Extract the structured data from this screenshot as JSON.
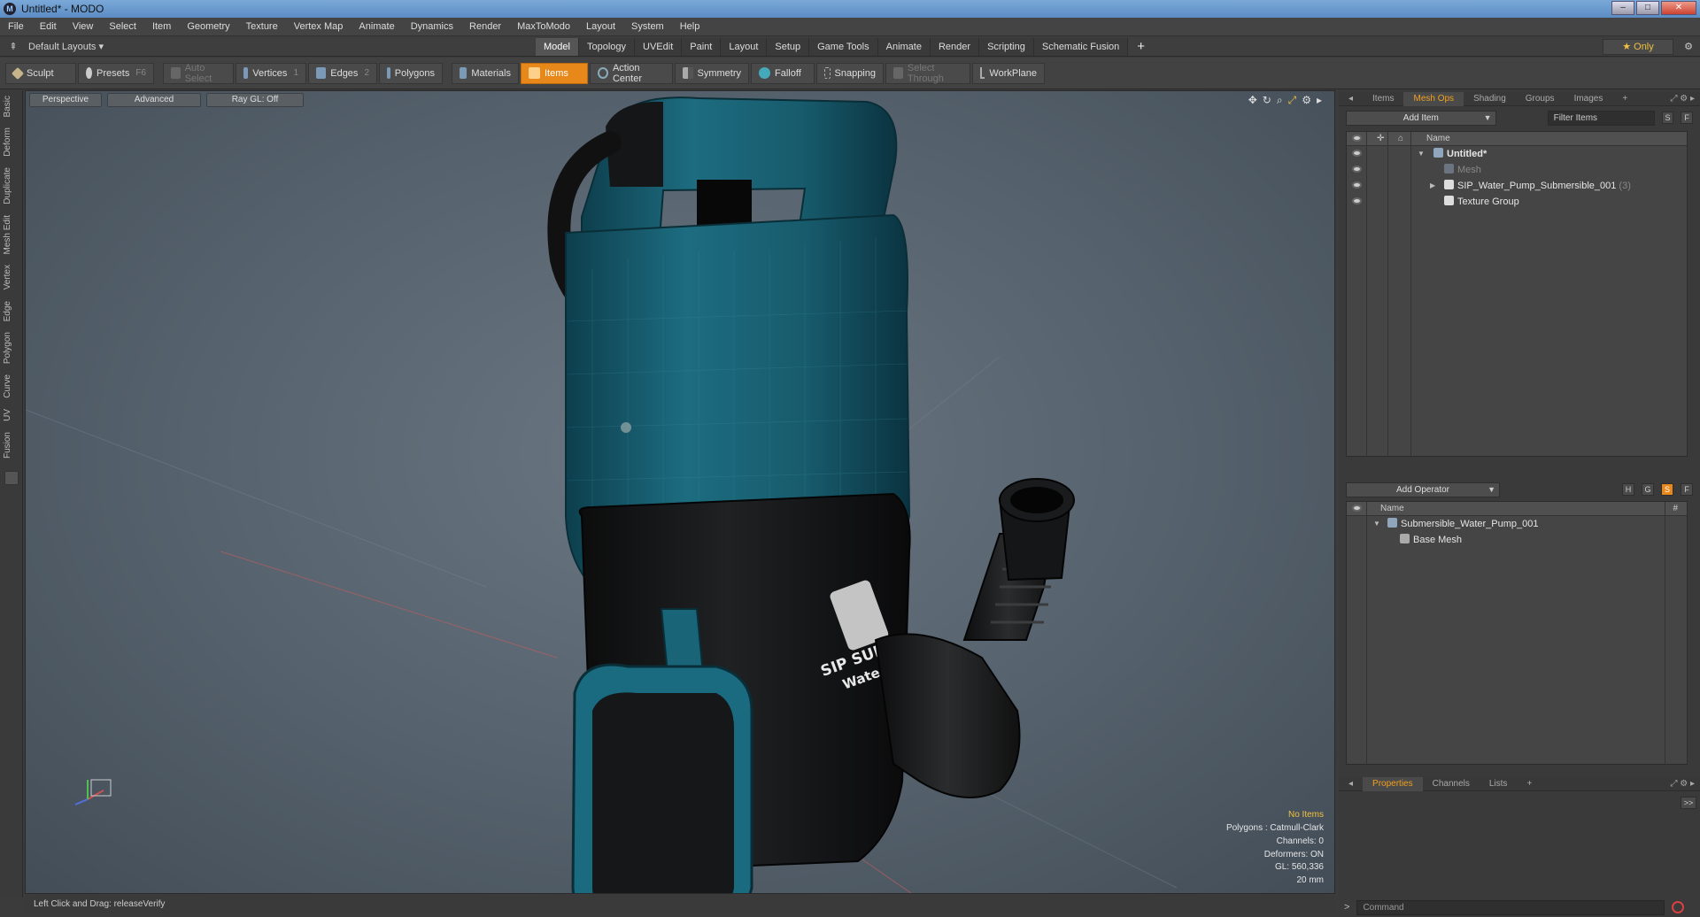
{
  "window": {
    "title": "Untitled* - MODO",
    "app_icon": "modo-logo-icon"
  },
  "menu": [
    "File",
    "Edit",
    "View",
    "Select",
    "Item",
    "Geometry",
    "Texture",
    "Vertex Map",
    "Animate",
    "Dynamics",
    "Render",
    "MaxToModo",
    "Layout",
    "System",
    "Help"
  ],
  "layout_bar": {
    "layout_name": "Default Layouts ▾",
    "tabs": [
      "Model",
      "Topology",
      "UVEdit",
      "Paint",
      "Layout",
      "Setup",
      "Game Tools",
      "Animate",
      "Render",
      "Scripting",
      "Schematic Fusion"
    ],
    "active_tab": "Model",
    "only_label": "★  Only"
  },
  "toolbar": {
    "sculpt": "Sculpt",
    "presets": "Presets",
    "presets_key": "F6",
    "auto_select": "Auto Select",
    "vertices": "Vertices",
    "vertices_key": "1",
    "edges": "Edges",
    "edges_key": "2",
    "polygons": "Polygons",
    "materials": "Materials",
    "items": "Items",
    "action_center": "Action Center",
    "symmetry": "Symmetry",
    "falloff": "Falloff",
    "snapping": "Snapping",
    "select_through": "Select Through",
    "workplane": "WorkPlane"
  },
  "left_tabs": [
    "Basic",
    "Deform",
    "Duplicate",
    "Mesh Edit",
    "Vertex",
    "Edge",
    "Polygon",
    "Curve",
    "UV",
    "Fusion"
  ],
  "viewport": {
    "view": "Perspective",
    "shading": "Advanced",
    "raygl": "Ray GL: Off",
    "logo_text": "SIP SUB",
    "logo_text2": "Water P",
    "stats": {
      "no_items": "No Items",
      "polygons": "Polygons : Catmull-Clark",
      "channels": "Channels: 0",
      "deformers": "Deformers: ON",
      "gl": "GL: 560,336",
      "scale": "20 mm"
    }
  },
  "status": "Left Click and Drag:  releaseVerify",
  "items_panel": {
    "tabs": [
      "Items",
      "Mesh Ops",
      "Shading",
      "Groups",
      "Images",
      "+"
    ],
    "active_tab": "Mesh Ops",
    "add_item": "Add Item",
    "filter": "Filter Items",
    "s_btn": "S",
    "f_btn": "F",
    "name_header": "Name",
    "rows": [
      {
        "label": "Untitled*",
        "style": "bold"
      },
      {
        "label": "Mesh",
        "style": "dim"
      },
      {
        "label": "SIP_Water_Pump_Submersible_001",
        "suffix": "(3)"
      },
      {
        "label": "Texture Group"
      }
    ]
  },
  "meshops_panel": {
    "add_operator": "Add Operator",
    "h_btn": "H",
    "g_btn": "G",
    "s_btn": "S",
    "f_btn": "F",
    "name_header": "Name",
    "hash_header": "#",
    "rows": [
      {
        "label": "Submersible_Water_Pump_001"
      },
      {
        "label": "Base Mesh"
      }
    ]
  },
  "properties_panel": {
    "tabs": [
      "Properties",
      "Channels",
      "Lists",
      "+"
    ],
    "active_tab": "Properties",
    "expand": ">>"
  },
  "command": {
    "placeholder": "Command"
  }
}
